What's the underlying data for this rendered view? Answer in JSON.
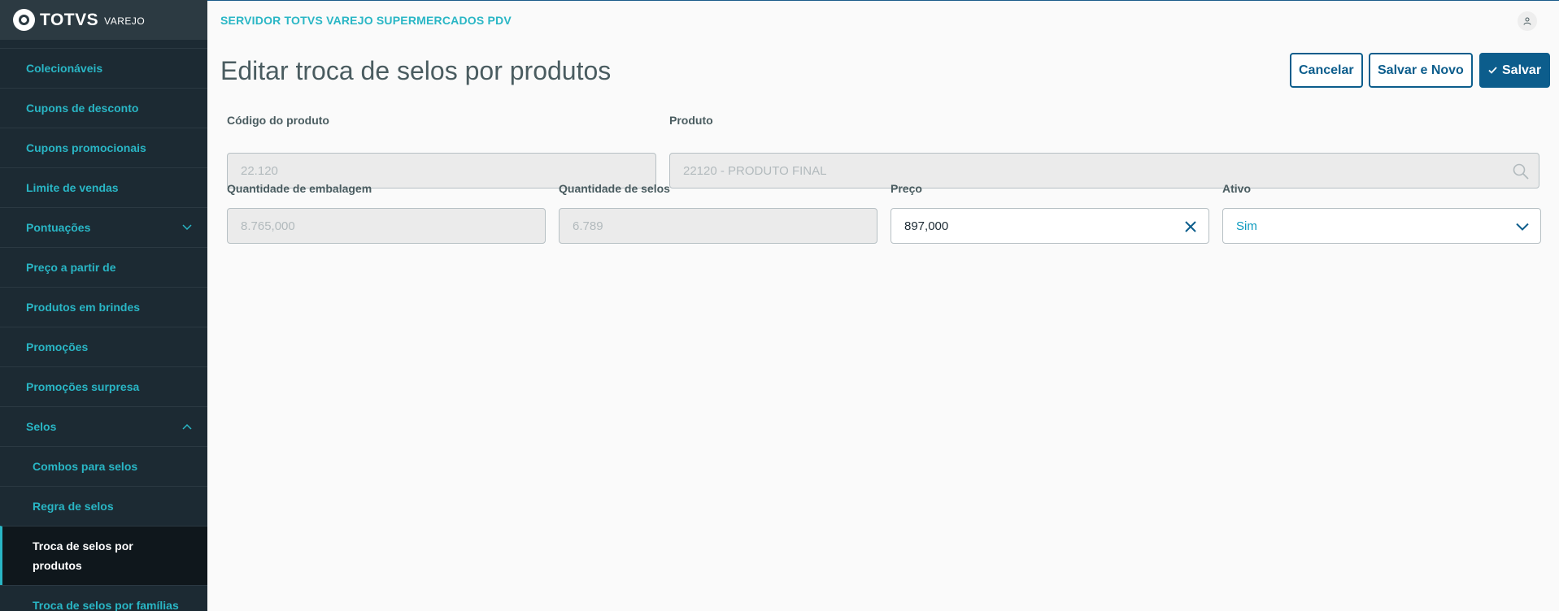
{
  "logo": {
    "brand": "TOTVS",
    "product": "VAREJO"
  },
  "header": {
    "server_title": "SERVIDOR TOTVS VAREJO SUPERMERCADOS PDV"
  },
  "sidebar": {
    "items": [
      {
        "label": "Colecionáveis"
      },
      {
        "label": "Cupons de desconto"
      },
      {
        "label": "Cupons promocionais"
      },
      {
        "label": "Limite de vendas"
      },
      {
        "label": "Pontuações",
        "expandable": "collapsed"
      },
      {
        "label": "Preço a partir de"
      },
      {
        "label": "Produtos em brindes"
      },
      {
        "label": "Promoções"
      },
      {
        "label": "Promoções surpresa"
      },
      {
        "label": "Selos",
        "expandable": "expanded"
      },
      {
        "label": "Combos para selos"
      },
      {
        "label": "Regra de selos"
      },
      {
        "label": "Troca de selos por produtos",
        "active": true
      },
      {
        "label": "Troca de selos por famílias"
      }
    ]
  },
  "page": {
    "title": "Editar troca de selos por produtos",
    "actions": {
      "cancel": "Cancelar",
      "save_new": "Salvar e Novo",
      "save": "Salvar"
    }
  },
  "form": {
    "codigo_label": "Código do produto",
    "codigo_value": "22.120",
    "produto_label": "Produto",
    "produto_value": "22120 - PRODUTO FINAL",
    "qtd_embalagem_label": "Quantidade de embalagem",
    "qtd_embalagem_value": "8.765,000",
    "qtd_selos_label": "Quantidade de selos",
    "qtd_selos_value": "6.789",
    "preco_label": "Preço",
    "preco_value": "897,000",
    "ativo_label": "Ativo",
    "ativo_value": "Sim"
  },
  "colors": {
    "sidebar_bg": "#1c2a33",
    "accent": "#29b6c5",
    "primary": "#0c5d8c",
    "title_text": "#4a5c60"
  },
  "icons": {
    "user": "user-icon",
    "search": "search-icon",
    "clear": "close-icon",
    "dropdown": "chevron-down-icon",
    "save": "check-icon"
  }
}
